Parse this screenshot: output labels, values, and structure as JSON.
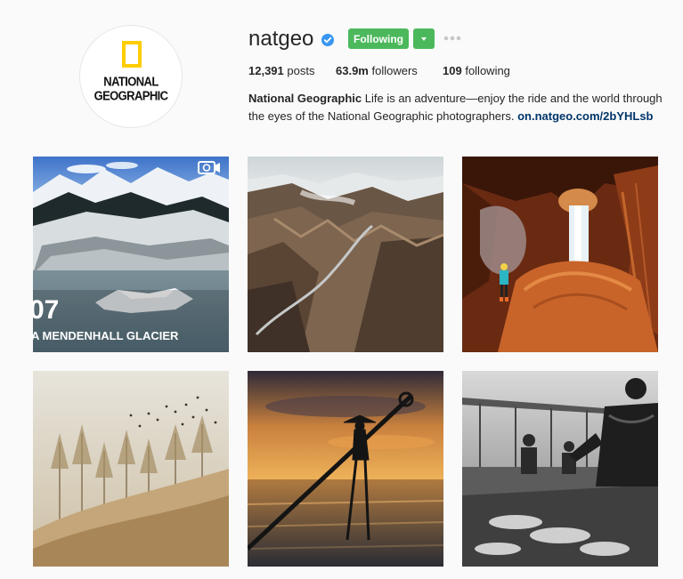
{
  "profile": {
    "username": "natgeo",
    "verified_icon": "verified-badge-icon",
    "logo_line1": "NATIONAL",
    "logo_line2": "GEOGRAPHIC",
    "follow_label": "Following",
    "follow_color": "#4cb85c",
    "accent_link_color": "#003569"
  },
  "stats": {
    "posts_count": "12,391",
    "posts_label": "posts",
    "followers_count": "63.9m",
    "followers_label": "followers",
    "following_count": "109",
    "following_label": "following"
  },
  "bio": {
    "name": "National Geographic",
    "text": " Life is an adventure—enjoy the ride and the world through the eyes of the National Geographic photographers. ",
    "link": "on.natgeo.com/2bYHLsb"
  },
  "posts": [
    {
      "subject": "glacier-photo",
      "number": "07",
      "caption": "A MENDENHALL GLACIER",
      "video_icon": "video-camera-icon"
    },
    {
      "subject": "mountain-valley-photo"
    },
    {
      "subject": "cave-waterfall-photo"
    },
    {
      "subject": "foggy-forest-birds-photo"
    },
    {
      "subject": "fisherman-sunset-photo"
    },
    {
      "subject": "fish-market-photo"
    }
  ]
}
